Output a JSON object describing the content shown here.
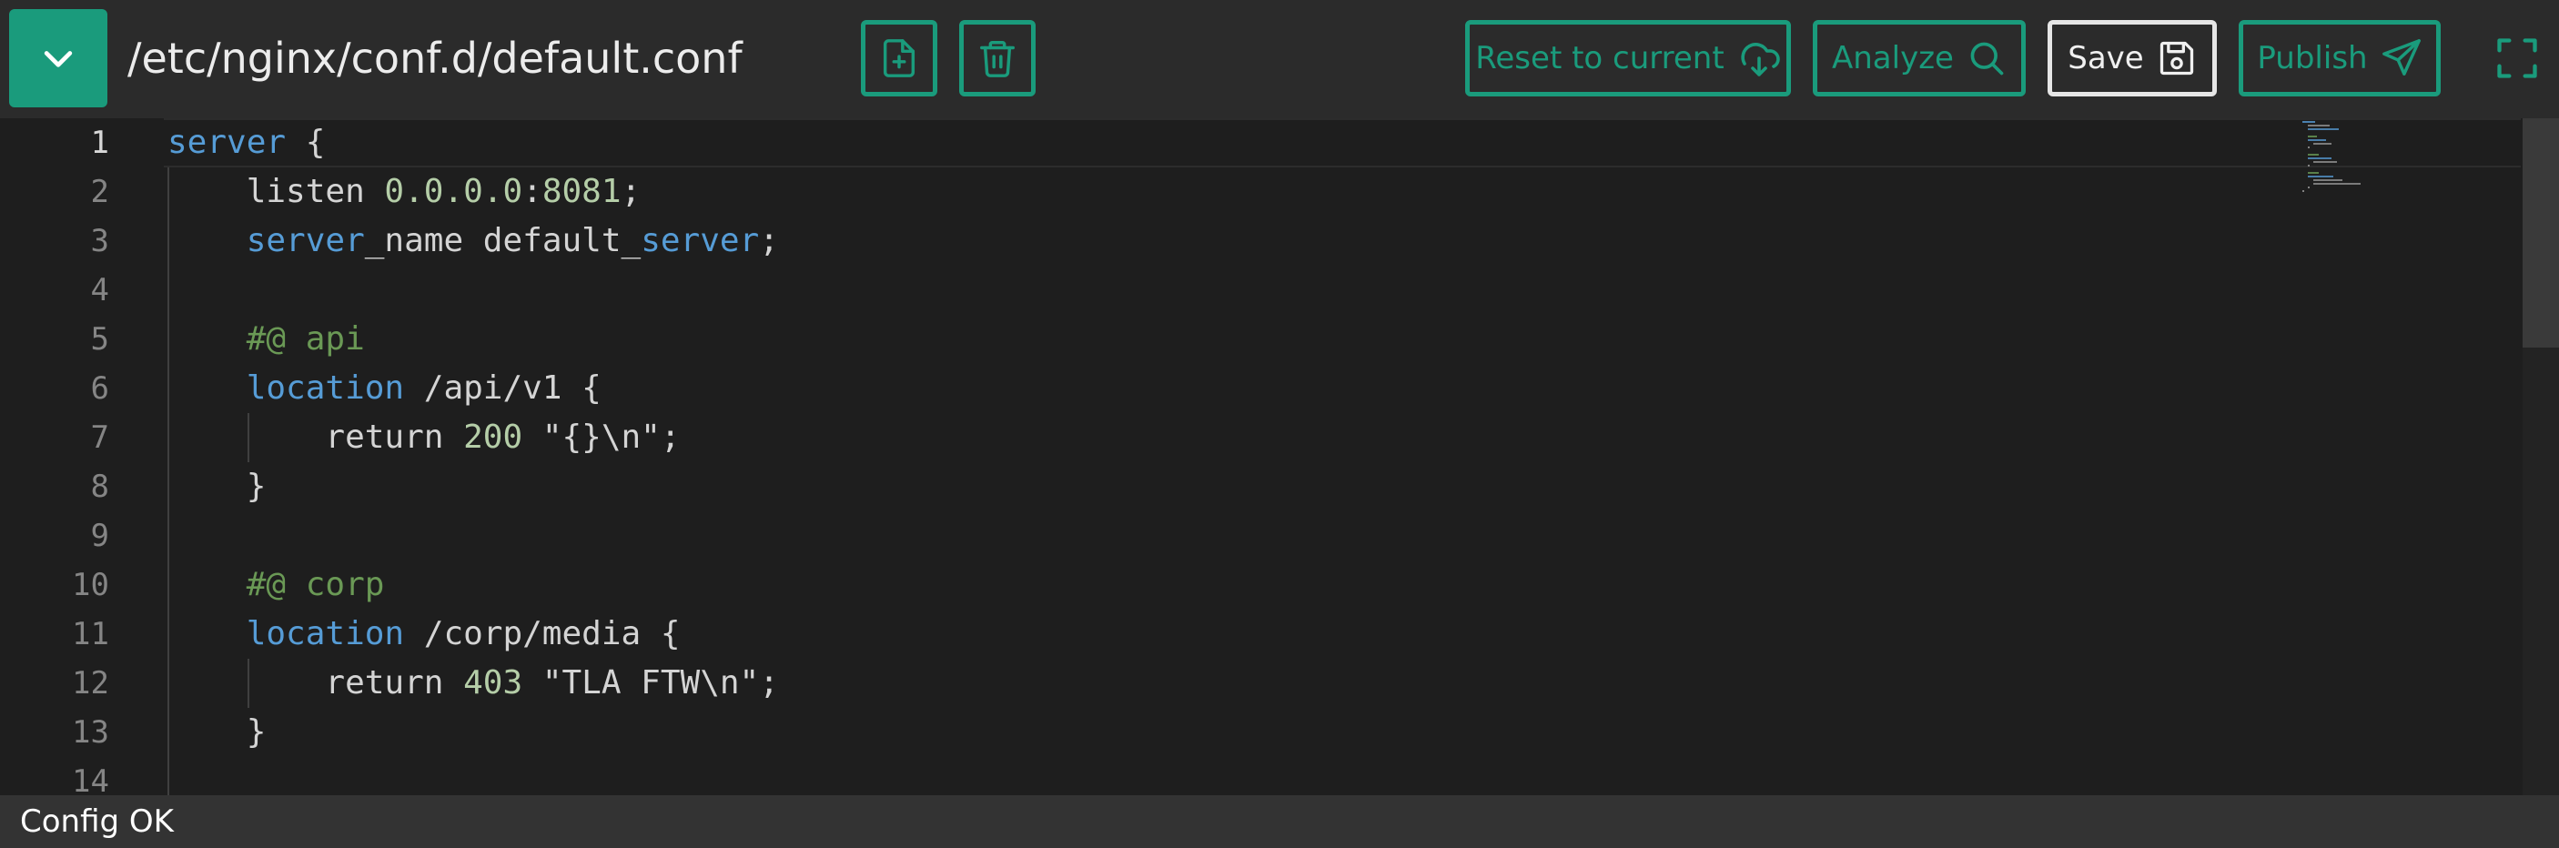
{
  "toolbar": {
    "file_path": "/etc/nginx/conf.d/default.conf",
    "reset_label": "Reset to current",
    "analyze_label": "Analyze",
    "save_label": "Save",
    "publish_label": "Publish"
  },
  "icons": {
    "dropdown": "chevron-down-icon",
    "new_file": "file-plus-icon",
    "delete": "trash-icon",
    "reset": "cloud-download-icon",
    "analyze": "search-icon",
    "save": "floppy-disk-icon",
    "publish": "send-icon",
    "fullscreen": "fullscreen-icon"
  },
  "colors": {
    "accent": "#1a9b7c",
    "toolbar_bg": "#2b2b2b",
    "editor_bg": "#1e1e1e",
    "keyword": "#569cd6",
    "number": "#b5cea8",
    "comment": "#6a9955"
  },
  "editor": {
    "active_line": 1,
    "line_numbers": [
      "1",
      "2",
      "3",
      "4",
      "5",
      "6",
      "7",
      "8",
      "9",
      "10",
      "11",
      "12",
      "13",
      "14"
    ],
    "lines": [
      [
        {
          "t": "server",
          "c": "kw"
        },
        {
          "t": " {"
        }
      ],
      [
        {
          "t": "    listen "
        },
        {
          "t": "0.0.0.0",
          "c": "num"
        },
        {
          "t": ":"
        },
        {
          "t": "8081",
          "c": "num"
        },
        {
          "t": ";"
        }
      ],
      [
        {
          "t": "    "
        },
        {
          "t": "server",
          "c": "kw"
        },
        {
          "t": "_name default_"
        },
        {
          "t": "server",
          "c": "kw"
        },
        {
          "t": ";"
        }
      ],
      [
        {
          "t": ""
        }
      ],
      [
        {
          "t": "    "
        },
        {
          "t": "#@ api",
          "c": "cm"
        }
      ],
      [
        {
          "t": "    "
        },
        {
          "t": "location",
          "c": "kw"
        },
        {
          "t": " /api/v1 {"
        }
      ],
      [
        {
          "t": "        return "
        },
        {
          "t": "200",
          "c": "num"
        },
        {
          "t": " \"{}\\n\";"
        }
      ],
      [
        {
          "t": "    }"
        }
      ],
      [
        {
          "t": ""
        }
      ],
      [
        {
          "t": "    "
        },
        {
          "t": "#@ corp",
          "c": "cm"
        }
      ],
      [
        {
          "t": "    "
        },
        {
          "t": "location",
          "c": "kw"
        },
        {
          "t": " /corp/media {"
        }
      ],
      [
        {
          "t": "        return "
        },
        {
          "t": "403",
          "c": "num"
        },
        {
          "t": " \"TLA FTW\\n\";"
        }
      ],
      [
        {
          "t": "    }"
        }
      ],
      [
        {
          "t": ""
        }
      ]
    ]
  },
  "status": {
    "text": "Config OK"
  }
}
